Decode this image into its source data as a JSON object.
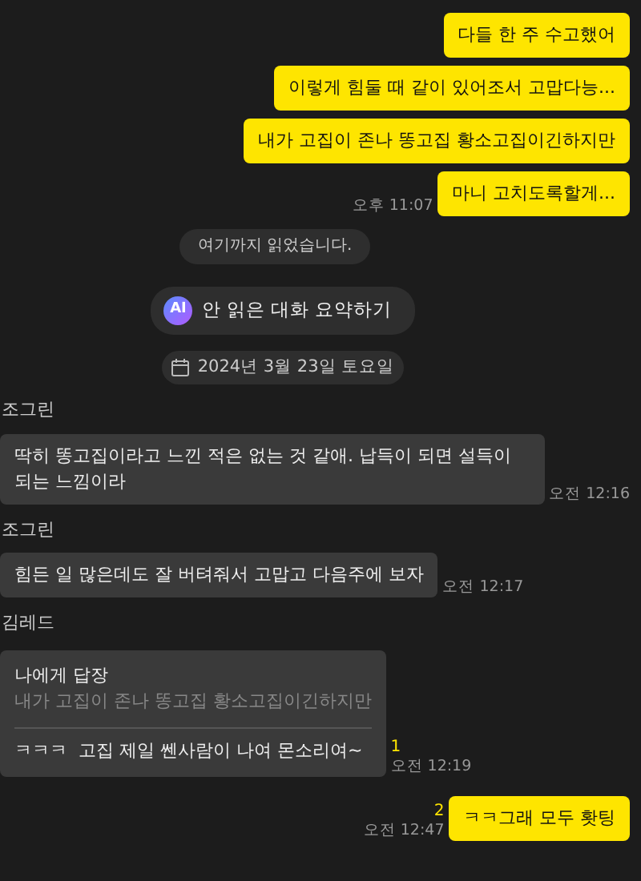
{
  "messages": [
    {
      "kind": "outgoing",
      "text": "다들 한 주 수고했어"
    },
    {
      "kind": "outgoing",
      "text": "이렇게 힘둘 때 같이 있어조서 고맙다능..."
    },
    {
      "kind": "outgoing",
      "text": "내가 고집이 존나 똥고집 황소고집이긴하지만"
    },
    {
      "kind": "outgoing",
      "text": "마니 고치도록할게...",
      "time": "오후 11:07"
    },
    {
      "kind": "notice",
      "text": "여기까지 읽었습니다."
    },
    {
      "kind": "ai",
      "badge": "AI",
      "text": "안 읽은 대화 요약하기"
    },
    {
      "kind": "date",
      "text": "2024년 3월 23일 토요일"
    },
    {
      "kind": "incoming",
      "sender": "조그린",
      "text": "딱히 똥고집이라고 느낀 적은 없는 것 같애. 납득이 되면 설득이 되는 느낌이라",
      "time": "오전 12:16"
    },
    {
      "kind": "incoming",
      "sender": "조그린",
      "text": "힘든 일 많은데도 잘 버텨줘서 고맙고 다음주에 보자",
      "time": "오전 12:17"
    },
    {
      "kind": "reply",
      "sender": "김레드",
      "reply_title": "나에게 답장",
      "quoted": "내가 고집이 존나 똥고집 황소고집이긴하지만",
      "text": "ㅋㅋㅋ  고집 제일 쎈사람이 나여 몬소리여~",
      "unread": "1",
      "time": "오전 12:19"
    },
    {
      "kind": "outgoing",
      "text": "ㅋㅋ그래 모두 홧팅",
      "unread": "2",
      "time": "오전 12:47"
    }
  ]
}
